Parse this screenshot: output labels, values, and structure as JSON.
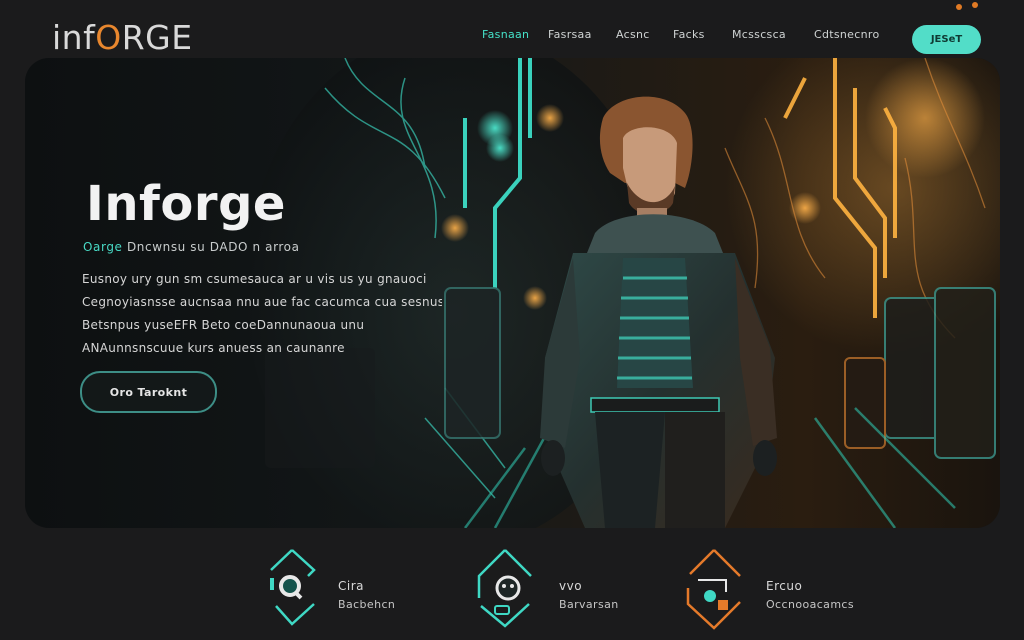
{
  "brand": {
    "logo_part1": "inf",
    "logo_part2": "O",
    "logo_part3": "RGE"
  },
  "nav": {
    "items": [
      {
        "label": "Fasnaan"
      },
      {
        "label": "Fasrsaa"
      },
      {
        "label": "Acsnc"
      },
      {
        "label": "Facks"
      },
      {
        "label": "Mcsscsca"
      },
      {
        "label": "Cdtsnecnro"
      }
    ],
    "cta_label": "JESeT"
  },
  "hero": {
    "title": "Inforge",
    "subtitle_accent": "Oarge",
    "subtitle_rest": "Dncwnsu su DADO n arroa",
    "body_lines": [
      "Eusnoy ury gun sm csumesauca ar u vis us yu gnauoci",
      "Cegnoyiasnsse aucnsaa nnu aue fac cacumca cua sesnusr",
      "Betsnpus yuseEFR Beto coeDannunaoua unu",
      "ANAunnsnscuue kurs anuess an caunanre"
    ],
    "button_label": "Oro Taroknt"
  },
  "features": [
    {
      "title": "Cira",
      "subtitle": "Bacbehcn",
      "icon": "search-diamond-icon",
      "color": "#3fd8c4"
    },
    {
      "title": "vvo",
      "subtitle": "Barvarsan",
      "icon": "face-diamond-icon",
      "color": "#3fd8c4"
    },
    {
      "title": "Ercuo",
      "subtitle": "Occnooacamcs",
      "icon": "lock-diamond-icon",
      "color": "#e57a2a"
    }
  ],
  "colors": {
    "accent": "#52ddc8",
    "brand_orange": "#e8872e",
    "background": "#1b1b1c"
  }
}
